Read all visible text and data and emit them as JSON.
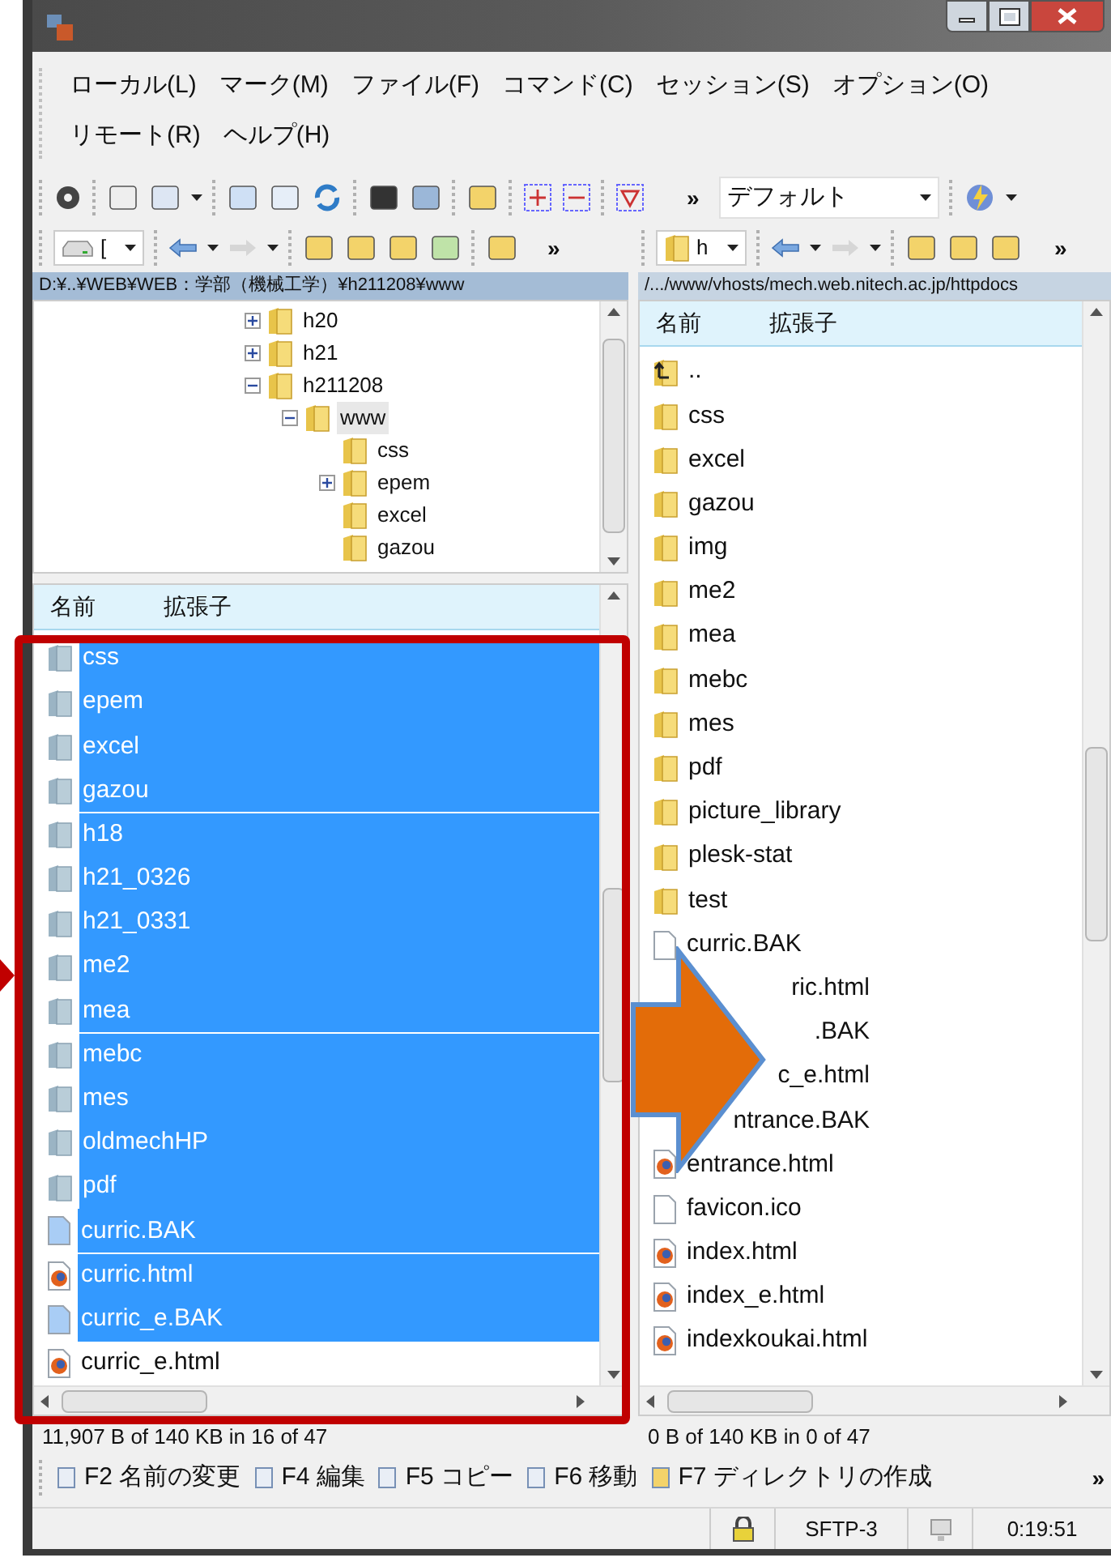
{
  "menu": [
    "ローカル(L)",
    "マーク(M)",
    "ファイル(F)",
    "コマンド(C)",
    "セッション(S)",
    "オプション(O)",
    "リモート(R)",
    "ヘルプ(H)"
  ],
  "toolbar": {
    "overflow": "»",
    "profile": "デフォルト"
  },
  "left": {
    "drive": "[",
    "overflow": "»",
    "path": "D:¥..¥WEB¥WEB：学部（機械工学）¥h211208¥www",
    "tree": [
      {
        "label": "h20",
        "kind": "branch",
        "expanded": false,
        "selected": false
      },
      {
        "label": "h21",
        "kind": "branch",
        "expanded": false,
        "selected": false
      },
      {
        "label": "h211208",
        "kind": "branch",
        "expanded": true,
        "selected": false,
        "children": [
          {
            "label": "www",
            "kind": "branch",
            "expanded": true,
            "selected": true,
            "children": [
              {
                "label": "css",
                "kind": "leaf",
                "selected": false
              },
              {
                "label": "epem",
                "kind": "branch",
                "expanded": false,
                "selected": false
              },
              {
                "label": "excel",
                "kind": "leaf",
                "selected": false
              },
              {
                "label": "gazou",
                "kind": "leaf",
                "selected": false
              }
            ]
          }
        ]
      }
    ],
    "columns": [
      "名前",
      "拡張子"
    ],
    "rows": [
      {
        "name": "css",
        "kind": "folder",
        "selected": true
      },
      {
        "name": "epem",
        "kind": "folder",
        "selected": true
      },
      {
        "name": "excel",
        "kind": "folder",
        "selected": true
      },
      {
        "name": "gazou",
        "kind": "folder",
        "selected": true
      },
      {
        "name": "h18",
        "kind": "folder",
        "selected": true
      },
      {
        "name": "h21_0326",
        "kind": "folder",
        "selected": true
      },
      {
        "name": "h21_0331",
        "kind": "folder",
        "selected": true
      },
      {
        "name": "me2",
        "kind": "folder",
        "selected": true
      },
      {
        "name": "mea",
        "kind": "folder",
        "selected": true
      },
      {
        "name": "mebc",
        "kind": "folder",
        "selected": true
      },
      {
        "name": "mes",
        "kind": "folder",
        "selected": true
      },
      {
        "name": "oldmechHP",
        "kind": "folder",
        "selected": true
      },
      {
        "name": "pdf",
        "kind": "folder",
        "selected": true
      },
      {
        "name": "curric.BAK",
        "kind": "file",
        "selected": true
      },
      {
        "name": "curric.html",
        "kind": "html",
        "selected": true
      },
      {
        "name": "curric_e.BAK",
        "kind": "file",
        "selected": true
      },
      {
        "name": "curric_e.html",
        "kind": "html",
        "selected": false
      }
    ],
    "status": "11,907 B of 140 KB in 16 of 47"
  },
  "right": {
    "drive": "h",
    "overflow": "»",
    "path": "/.../www/vhosts/mech.web.nitech.ac.jp/httpdocs",
    "columns": [
      "名前",
      "拡張子"
    ],
    "rows": [
      {
        "name": "..",
        "kind": "up",
        "covered": false
      },
      {
        "name": "css",
        "kind": "folder",
        "covered": false
      },
      {
        "name": "excel",
        "kind": "folder",
        "covered": false
      },
      {
        "name": "gazou",
        "kind": "folder",
        "covered": false
      },
      {
        "name": "img",
        "kind": "folder",
        "covered": false
      },
      {
        "name": "me2",
        "kind": "folder",
        "covered": false
      },
      {
        "name": "mea",
        "kind": "folder",
        "covered": false
      },
      {
        "name": "mebc",
        "kind": "folder",
        "covered": false
      },
      {
        "name": "mes",
        "kind": "folder",
        "covered": false
      },
      {
        "name": "pdf",
        "kind": "folder",
        "covered": false
      },
      {
        "name": "picture_library",
        "kind": "folder",
        "covered": false
      },
      {
        "name": "plesk-stat",
        "kind": "folder",
        "covered": false
      },
      {
        "name": "test",
        "kind": "folder",
        "covered": false
      },
      {
        "name": "curric.BAK",
        "kind": "file",
        "covered": false
      },
      {
        "name": "ric.html",
        "covered": true
      },
      {
        "name": ".BAK",
        "covered": true
      },
      {
        "name": "c_e.html",
        "covered": true
      },
      {
        "name": "ntrance.BAK",
        "covered": true
      },
      {
        "name": "entrance.html",
        "kind": "html",
        "covered": false
      },
      {
        "name": "favicon.ico",
        "kind": "file",
        "covered": false
      },
      {
        "name": "index.html",
        "kind": "html",
        "covered": false
      },
      {
        "name": "index_e.html",
        "kind": "html",
        "covered": false
      },
      {
        "name": "indexkoukai.html",
        "kind": "html",
        "covered": false
      }
    ],
    "status": "0 B of 140 KB in 0 of 47"
  },
  "function_keys": [
    "F2 名前の変更",
    "F4 編集",
    "F5 コピー",
    "F6 移動",
    "F7 ディレクトリの作成"
  ],
  "function_overflow": "»",
  "status_bar": {
    "protocol": "SFTP-3",
    "time": "0:19:51"
  }
}
